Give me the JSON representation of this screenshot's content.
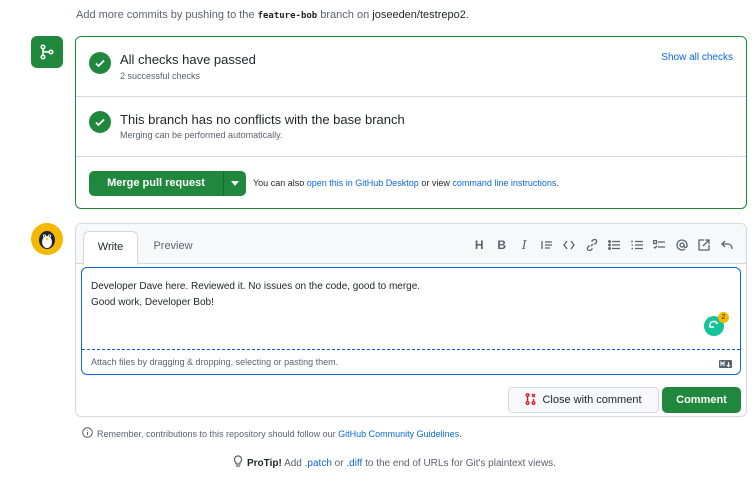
{
  "top_note": {
    "prefix": "Add more commits by pushing to the",
    "branch": "feature-bob",
    "middle": "branch on",
    "repo": "joseeden/testrepo2",
    "suffix": "."
  },
  "checks": {
    "passed_title": "All checks have passed",
    "passed_sub": "2 successful checks",
    "show_all": "Show all checks",
    "conflicts_title": "This branch has no conflicts with the base branch",
    "conflicts_sub": "Merging can be performed automatically."
  },
  "merge": {
    "button_label": "Merge pull request",
    "help_prefix": "You can also",
    "help_link1": "open this in GitHub Desktop",
    "help_middle": "or view",
    "help_link2": "command line instructions",
    "help_suffix": "."
  },
  "comment": {
    "tabs": [
      "Write",
      "Preview"
    ],
    "toolbar": [
      "heading-icon",
      "bold-icon",
      "italic-icon",
      "quote-icon",
      "code-icon",
      "link-icon",
      "unordered-list-icon",
      "ordered-list-icon",
      "task-list-icon",
      "mention-icon",
      "cross-reference-icon",
      "reply-icon"
    ],
    "text": "Developer Dave here. Reviewed it. No issues on the code, good to merge.\nGood work, Developer Bob!",
    "attach_hint": "Attach files by dragging & dropping, selecting or pasting them.",
    "grammarly_count": "2",
    "close_label": "Close with comment",
    "comment_label": "Comment"
  },
  "footer": {
    "guidelines_prefix": "Remember, contributions to this repository should follow our",
    "guidelines_link": "GitHub Community Guidelines",
    "guidelines_suffix": ".",
    "protip_label": "ProTip!",
    "protip_a": "Add",
    "protip_patch": ".patch",
    "protip_or": "or",
    "protip_diff": ".diff",
    "protip_rest": "to the end of URLs for Git's plaintext views."
  },
  "colors": {
    "success": "#1f883d",
    "link": "#0969da",
    "avatar": "#f5b800"
  }
}
